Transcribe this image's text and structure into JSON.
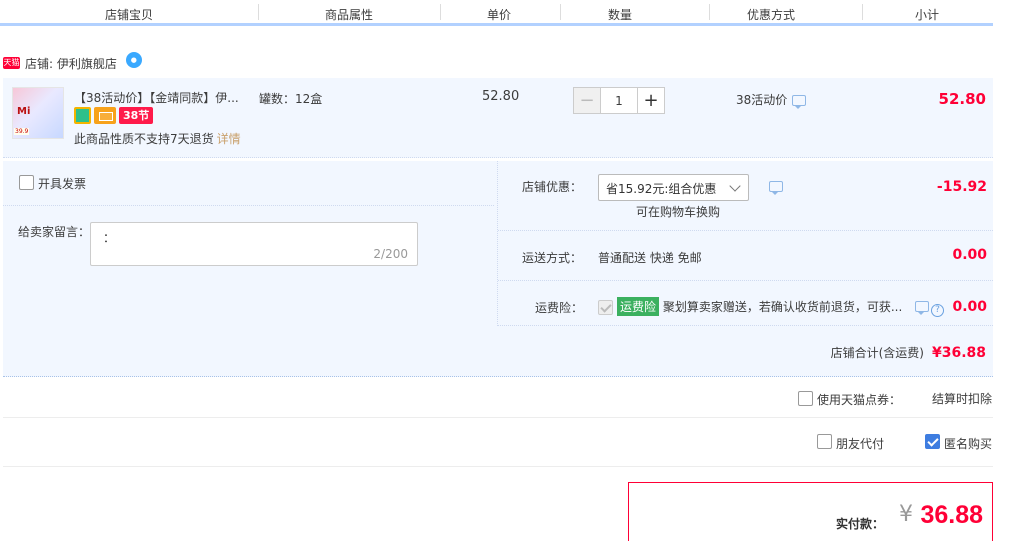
{
  "header": {
    "columns": [
      "店铺宝贝",
      "商品属性",
      "单价",
      "数量",
      "优惠方式",
      "小计"
    ]
  },
  "shop": {
    "badge": "天猫",
    "name": "店铺: 伊利旗舰店",
    "ww_icon": "chat-bubble-icon"
  },
  "item": {
    "title": "【38活动价】【金靖同款】伊...",
    "thumb_text": "Mi",
    "thumb_price": "39.9",
    "service_badge": "38节",
    "no_return": "此商品性质不支持7天退货",
    "details_link": "详情",
    "sku": "罐数：12盒",
    "unit_price": "52.80",
    "quantity": "1",
    "minus": "−",
    "plus": "+",
    "promo": "38活动价",
    "subtotal": "52.80"
  },
  "options": {
    "invoice_label": "开具发票",
    "memo_label": "给卖家留言：",
    "memo_value": "：",
    "memo_count": "2/200",
    "shop_discount_label": "店铺优惠：",
    "shop_discount_value": "省15.92元:组合优惠",
    "shop_discount_hint": "可在购物车换购",
    "shop_discount_amount": "-15.92",
    "shipping_label": "运送方式：",
    "shipping_value": "普通配送 快递 免邮",
    "shipping_amount": "0.00",
    "insurance_label": "运费险：",
    "insurance_tag": "运费险",
    "insurance_text": "聚划算卖家赠送，若确认收货前退货，可获...",
    "insurance_amount": "0.00",
    "shop_total_label": "店铺合计(含运费)",
    "shop_total_amount": "¥36.88"
  },
  "footer": {
    "tmall_points_label": "使用天猫点券：",
    "tmall_points_note": "结算时扣除",
    "friend_pay_label": "朋友代付",
    "anonymous_label": "匿名购买",
    "anonymous_checked": true,
    "pay_label": "实付款：",
    "yen": "¥",
    "pay_amount": "36.88"
  },
  "colors": {
    "accent_red": "#ff0036",
    "row_bg": "#f2f7ff",
    "header_border": "#b2d1ff"
  }
}
